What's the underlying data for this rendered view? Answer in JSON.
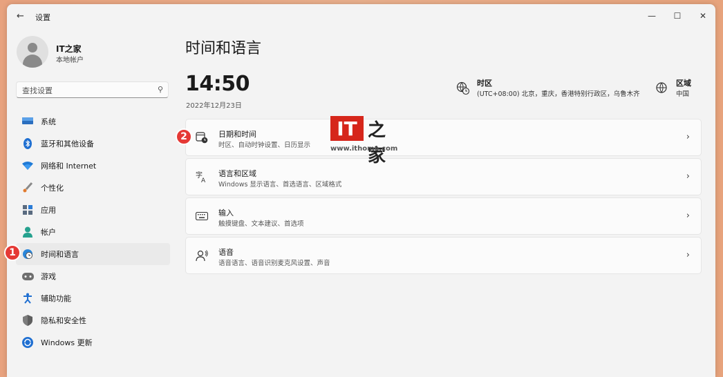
{
  "window": {
    "title": "设置",
    "back_glyph": "←",
    "minimize": "—",
    "maximize": "☐",
    "close": "✕"
  },
  "profile": {
    "name": "IT之家",
    "account_type": "本地帐户"
  },
  "search": {
    "placeholder": "查找设置"
  },
  "sidebar": {
    "items": [
      {
        "label": "系统",
        "icon": "monitor-icon"
      },
      {
        "label": "蓝牙和其他设备",
        "icon": "bluetooth-icon"
      },
      {
        "label": "网络和 Internet",
        "icon": "wifi-icon"
      },
      {
        "label": "个性化",
        "icon": "paintbrush-icon"
      },
      {
        "label": "应用",
        "icon": "apps-icon"
      },
      {
        "label": "帐户",
        "icon": "person-icon"
      },
      {
        "label": "时间和语言",
        "icon": "globe-clock-icon",
        "selected": true
      },
      {
        "label": "游戏",
        "icon": "gamepad-icon"
      },
      {
        "label": "辅助功能",
        "icon": "accessibility-icon"
      },
      {
        "label": "隐私和安全性",
        "icon": "shield-icon"
      },
      {
        "label": "Windows 更新",
        "icon": "update-icon"
      }
    ]
  },
  "main": {
    "title": "时间和语言",
    "time": "14:50",
    "date": "2022年12月23日",
    "timezone": {
      "title": "时区",
      "value": "(UTC+08:00) 北京，重庆，香港特别行政区，乌鲁木齐"
    },
    "region": {
      "title": "区域",
      "value": "中国"
    },
    "cards": [
      {
        "title": "日期和时间",
        "subtitle": "时区、自动时钟设置、日历显示",
        "icon": "calendar-clock-icon"
      },
      {
        "title": "语言和区域",
        "subtitle": "Windows 显示语言、首选语言、区域格式",
        "icon": "language-icon"
      },
      {
        "title": "输入",
        "subtitle": "触摸键盘、文本建议、首选项",
        "icon": "keyboard-icon"
      },
      {
        "title": "语音",
        "subtitle": "语音语言、语音识别麦克风设置、声音",
        "icon": "speech-icon"
      }
    ]
  },
  "annotations": {
    "badge1": "1",
    "badge2": "2"
  },
  "watermark": {
    "logo": "IT",
    "logo_cn": "之家",
    "url": "www.ithome.com"
  },
  "colors": {
    "accent": "#005fb8",
    "badge": "#e53935",
    "logo_red": "#d6261b"
  }
}
